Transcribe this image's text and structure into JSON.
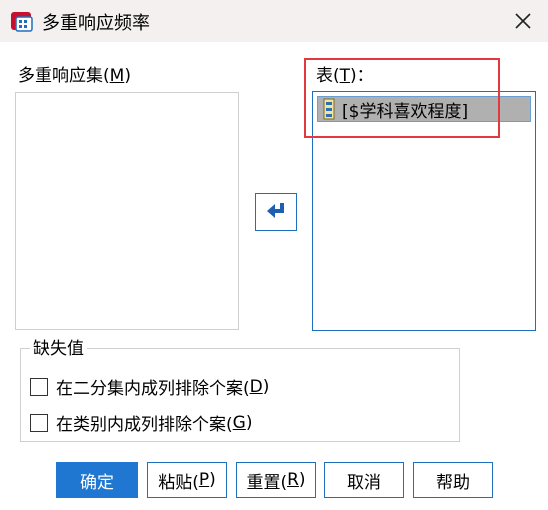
{
  "window": {
    "title": "多重响应频率",
    "close_icon": "close-icon",
    "app_icon": "spss-dialog-icon"
  },
  "source": {
    "label_text": "多重响应集(",
    "label_mnemonic": "M",
    "label_end": ")",
    "items": []
  },
  "table": {
    "label_text": "表(",
    "label_mnemonic": "T",
    "label_end": ")：",
    "items": [
      {
        "label": "[$学科喜欢程度]",
        "icon": "multiple-response-set-icon"
      }
    ]
  },
  "move_button": {
    "icon": "move-arrow-icon"
  },
  "missing": {
    "title": "缺失值",
    "options": [
      {
        "text": "在二分集内成列排除个案(",
        "mnemonic": "D",
        "end": ")",
        "checked": false
      },
      {
        "text": "在类别内成列排除个案(",
        "mnemonic": "G",
        "end": ")",
        "checked": false
      }
    ]
  },
  "buttons": {
    "ok": "确定",
    "paste_text": "粘贴(",
    "paste_mnemonic": "P",
    "paste_end": ")",
    "reset_text": "重置(",
    "reset_mnemonic": "R",
    "reset_end": ")",
    "cancel": "取消",
    "help": "帮助"
  },
  "colors": {
    "accent": "#1f77d1",
    "border_blue": "#1f6fbf",
    "annotation_red": "#e0393e",
    "selected_item": "#b0b0b0"
  }
}
